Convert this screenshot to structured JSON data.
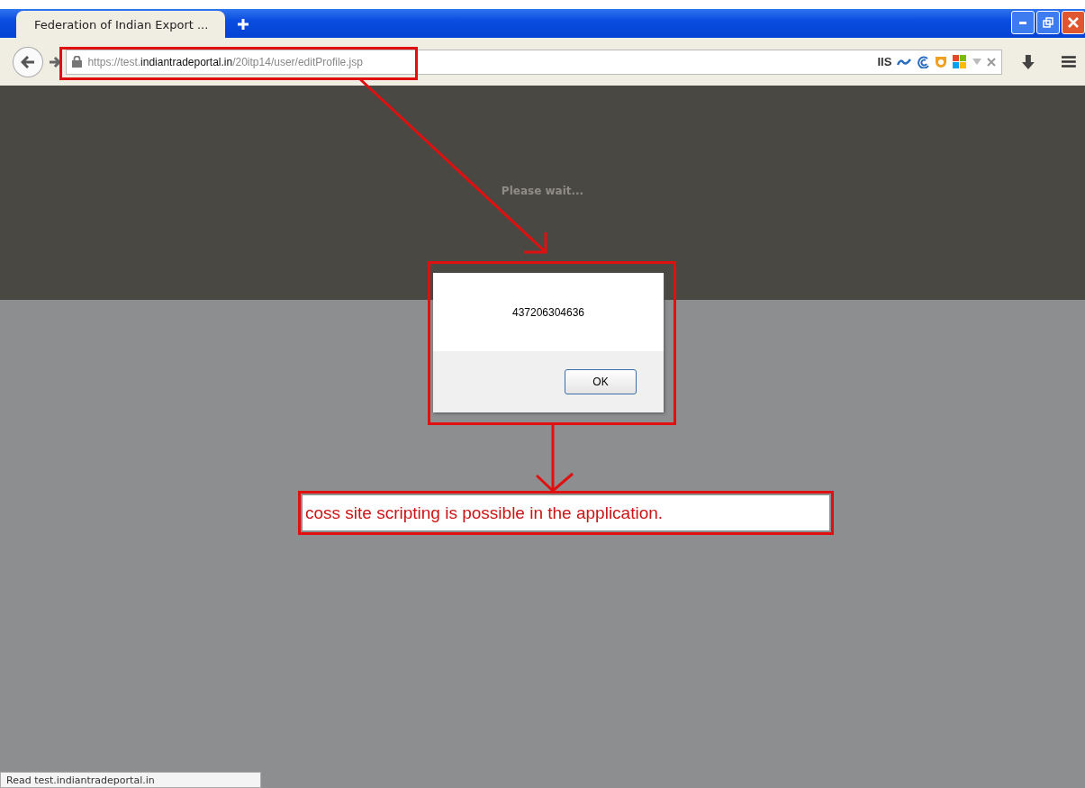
{
  "tab": {
    "title": "Federation of Indian Export ...",
    "selected": true
  },
  "address_bar": {
    "url": [
      "https://test.",
      "indiantradeportal.in",
      "/20itp14/user/editProfile.jsp"
    ],
    "extension_label": "IIS"
  },
  "page": {
    "loading_text": "Please wait..."
  },
  "alert": {
    "message": "437206304636",
    "button": "OK"
  },
  "annotation": {
    "note": "coss site scripting is possible in the application."
  },
  "status_bar": {
    "text": "Read test.indiantradeportal.in"
  }
}
